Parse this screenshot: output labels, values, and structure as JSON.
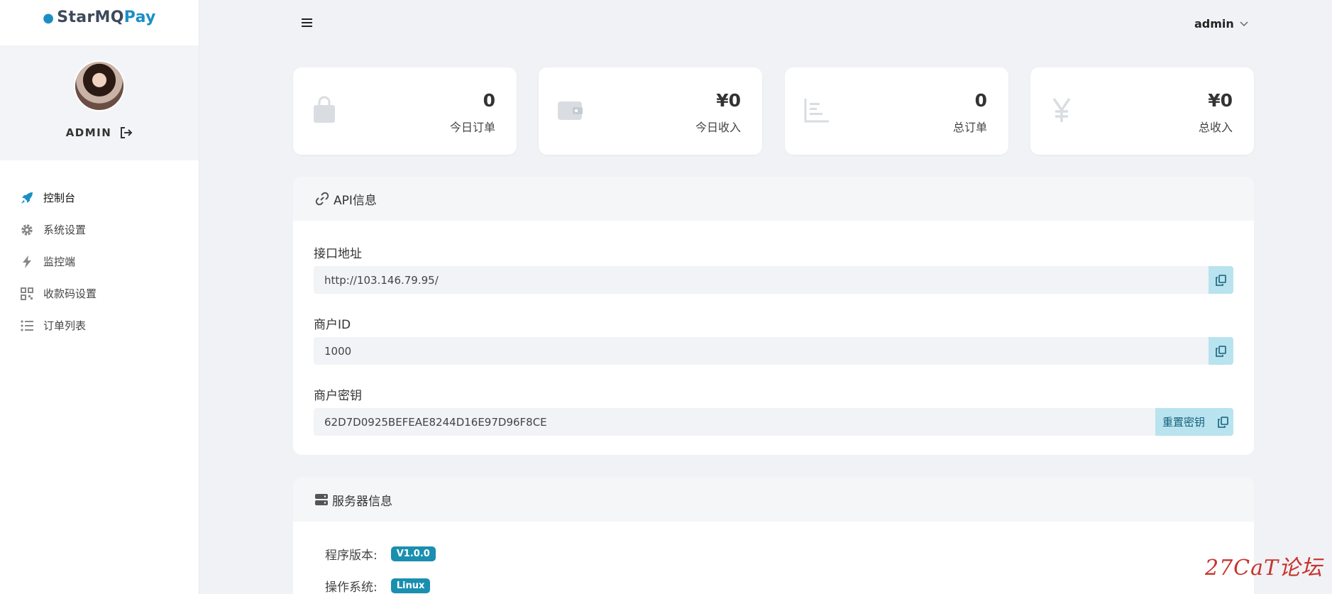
{
  "brand": {
    "part1": "StarMQ",
    "part2": "Pay",
    "accent": "#1b8fc4"
  },
  "profile": {
    "name": "ADMIN"
  },
  "nav": [
    {
      "label": "控制台",
      "icon": "rocket-icon"
    },
    {
      "label": "系统设置",
      "icon": "gear-icon"
    },
    {
      "label": "监控端",
      "icon": "bolt-icon"
    },
    {
      "label": "收款码设置",
      "icon": "qrcode-icon"
    },
    {
      "label": "订单列表",
      "icon": "list-icon"
    }
  ],
  "topbar": {
    "user": "admin"
  },
  "stats": [
    {
      "value": "0",
      "label": "今日订单",
      "icon": "shopping-bag-icon"
    },
    {
      "value": "¥0",
      "label": "今日收入",
      "icon": "wallet-icon"
    },
    {
      "value": "0",
      "label": "总订单",
      "icon": "bar-chart-icon"
    },
    {
      "value": "¥0",
      "label": "总收入",
      "icon": "yen-icon"
    }
  ],
  "api": {
    "title": "API信息",
    "endpoint_label": "接口地址",
    "endpoint": "http://103.146.79.95/",
    "merchant_id_label": "商户ID",
    "merchant_id": "1000",
    "merchant_key_label": "商户密钥",
    "merchant_key": "62D7D0925BEFEAE8244D16E97D96F8CE",
    "reset_label": "重置密钥"
  },
  "server": {
    "title": "服务器信息",
    "version_label": "程序版本:",
    "version": "V1.0.0",
    "os_label": "操作系统:",
    "os": "Linux"
  },
  "watermark": "27CaT论坛"
}
